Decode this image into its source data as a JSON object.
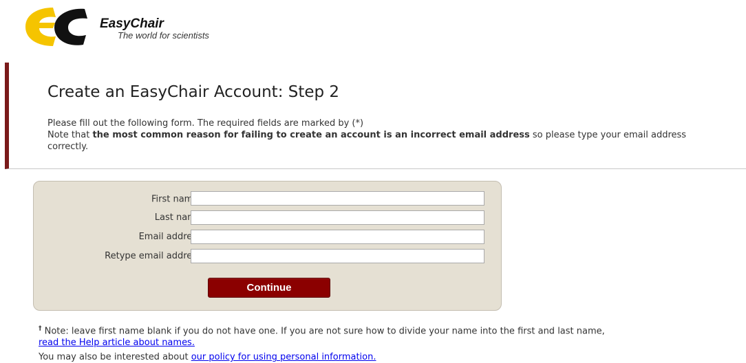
{
  "header": {
    "logo_name": "EasyChair",
    "logo_tagline": "The world for scientists"
  },
  "page": {
    "title": "Create an EasyChair Account: Step 2",
    "intro_line1": "Please fill out the following form. The required fields are marked by (*)",
    "intro_line2_prefix": "Note that ",
    "intro_line2_bold": "the most common reason for failing to create an account is an incorrect email address",
    "intro_line2_suffix": " so please type your email address correctly."
  },
  "form": {
    "first_name_label": "First name",
    "first_name_dagger": "†",
    "first_name_required": " (*):",
    "first_name_value": "",
    "last_name_label": "Last name (*):",
    "last_name_value": "",
    "email_label": "Email address (*):",
    "email_value": "",
    "retype_email_label": "Retype email address (*):",
    "retype_email_value": "",
    "continue_label": "Continue"
  },
  "notes": {
    "dagger": "†",
    "note_text": " Note: leave first name blank if you do not have one. If you are not sure how to divide your name into the first and last name,",
    "help_link": "read the Help article about names.",
    "policy_prefix": "You may also be interested about ",
    "policy_link": "our policy for using personal information."
  },
  "colors": {
    "accent_bar": "#7a1a1a",
    "button": "#8b0000",
    "form_background": "#e5e0d3",
    "logo_yellow": "#f5c400",
    "logo_black": "#111111",
    "link": "#0000ee"
  }
}
